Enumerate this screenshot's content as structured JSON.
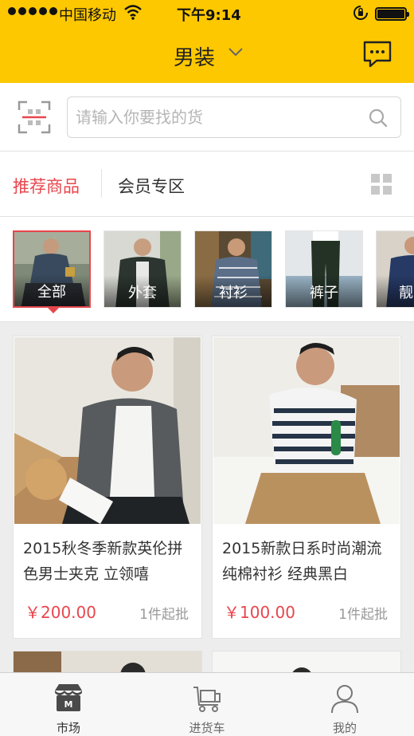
{
  "status_bar": {
    "carrier": "中国移动",
    "time": "下午9:14"
  },
  "nav": {
    "title": "男装"
  },
  "search": {
    "placeholder": "请输入你要找的货",
    "value": ""
  },
  "tabs": {
    "active": "推荐商品",
    "other": "会员专区"
  },
  "categories": [
    {
      "label": "全部"
    },
    {
      "label": "外套"
    },
    {
      "label": "衬衫"
    },
    {
      "label": "裤子"
    },
    {
      "label": "靓"
    }
  ],
  "products": [
    {
      "title": "2015秋冬季新款英伦拼色男士夹克 立领嘻",
      "price": "￥200.00",
      "moq": "1件起批"
    },
    {
      "title": "2015新款日系时尚潮流纯棉衬衫 经典黑白",
      "price": "￥100.00",
      "moq": "1件起批"
    }
  ],
  "tabbar": [
    {
      "label": "市场",
      "icon": "market-icon"
    },
    {
      "label": "进货车",
      "icon": "cart-icon"
    },
    {
      "label": "我的",
      "icon": "user-icon"
    }
  ],
  "colors": {
    "brand_yellow": "#fdc800",
    "accent_red": "#e8464d"
  }
}
